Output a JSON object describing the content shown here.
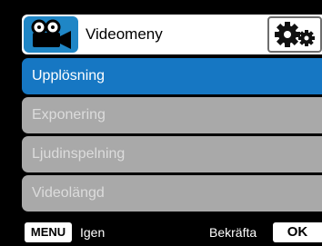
{
  "header": {
    "title": "Videomeny",
    "left_icon": "video-camera-icon",
    "right_icon": "gears-icon"
  },
  "menu": {
    "items": [
      {
        "label": "Upplösning",
        "selected": true
      },
      {
        "label": "Exponering",
        "selected": false
      },
      {
        "label": "Ljudinspelning",
        "selected": false
      },
      {
        "label": "Videolängd",
        "selected": false
      }
    ]
  },
  "footer": {
    "menu_key": "MENU",
    "menu_action": "Igen",
    "confirm_action": "Bekräfta",
    "ok_key": "OK"
  },
  "colors": {
    "accent": "#1677c3",
    "icon_blue": "#1f86c6",
    "item_gray": "#a9a9a9",
    "background": "#000000"
  }
}
